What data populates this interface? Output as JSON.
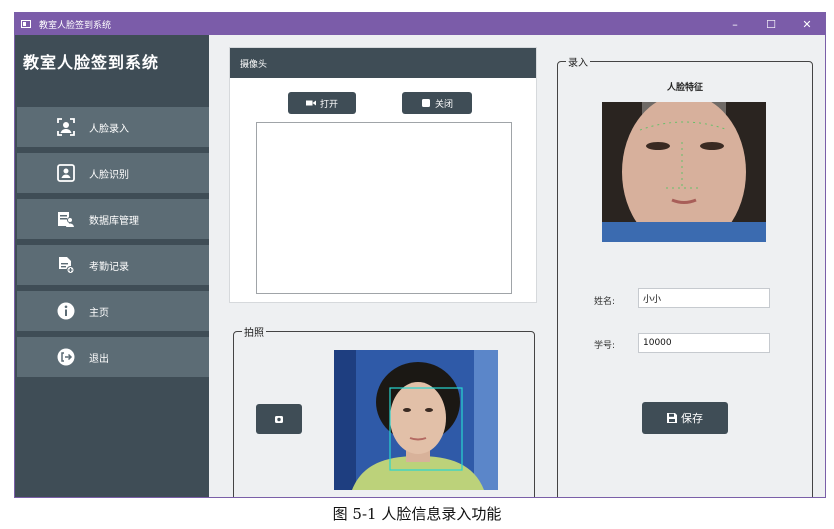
{
  "window": {
    "title": "教室人脸签到系统",
    "controls": [
      "–",
      "☐",
      "✕"
    ]
  },
  "sidebar": {
    "app_title": "教室人脸签到系统",
    "items": [
      {
        "label": "人脸录入",
        "icon": "face-scan-icon"
      },
      {
        "label": "人脸识别",
        "icon": "face-frame-icon"
      },
      {
        "label": "数据库管理",
        "icon": "database-user-icon"
      },
      {
        "label": "考勤记录",
        "icon": "document-add-icon"
      },
      {
        "label": "主页",
        "icon": "info-icon"
      },
      {
        "label": "退出",
        "icon": "logout-icon"
      }
    ]
  },
  "camera": {
    "header": "摄像头",
    "open_label": "打开",
    "close_label": "关闭"
  },
  "photo": {
    "legend": "拍照"
  },
  "entry": {
    "legend": "录入",
    "feature_title": "人脸特征",
    "name_label": "姓名:",
    "name_value": "小小",
    "id_label": "学号:",
    "id_value": "10000",
    "save_label": "保存"
  },
  "caption": "图 5-1  人脸信息录入功能",
  "colors": {
    "titlebar": "#7b5ca9",
    "sidebar": "#3f4d56",
    "nav_item": "#5c6c75",
    "button": "#3f4d56"
  }
}
